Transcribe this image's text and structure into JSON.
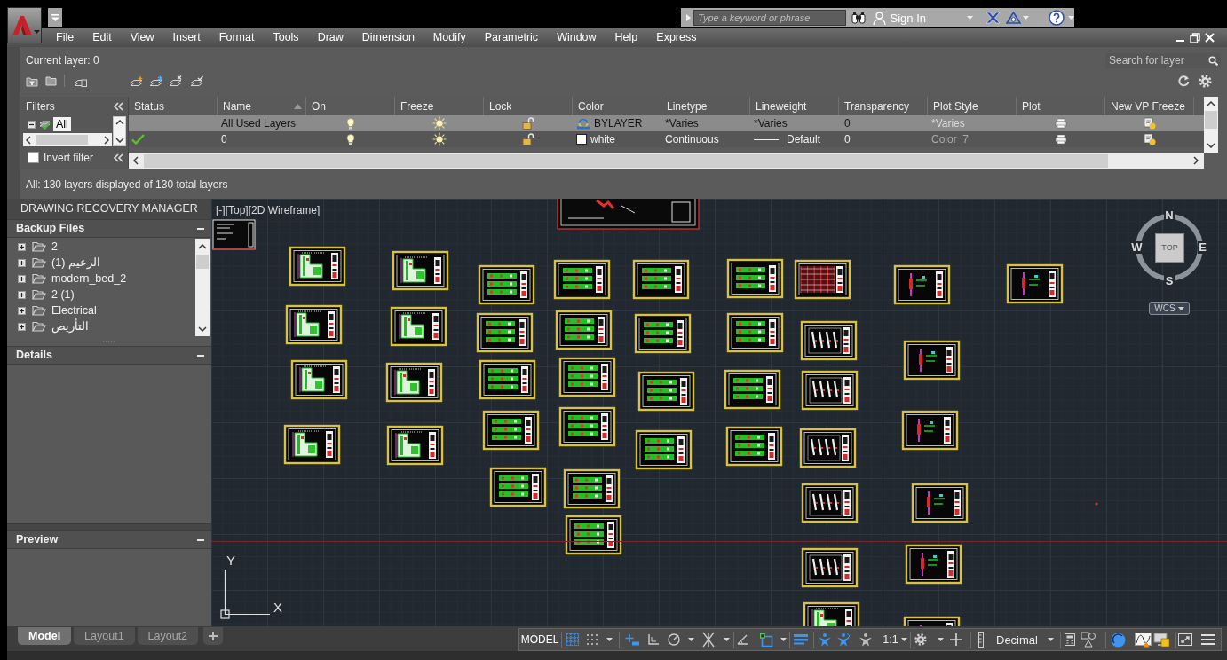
{
  "title_bar": {
    "search": {
      "placeholder": "Type a keyword or phrase"
    },
    "sign_in": "Sign In"
  },
  "menu_bar": [
    "File",
    "Edit",
    "View",
    "Insert",
    "Format",
    "Tools",
    "Draw",
    "Dimension",
    "Modify",
    "Parametric",
    "Window",
    "Help",
    "Express"
  ],
  "layer_manager": {
    "current_layer": "Current layer: 0",
    "search": {
      "placeholder": "Search for layer"
    },
    "filters": {
      "title": "Filters",
      "items": [
        {
          "label": "All",
          "selected": true,
          "expanded": true
        }
      ],
      "invert_filter": {
        "label": "Invert filter",
        "checked": false
      }
    },
    "columns": [
      {
        "label": "Status",
        "sorted": false
      },
      {
        "label": "Name",
        "sorted": true
      },
      {
        "label": "On",
        "sorted": false
      },
      {
        "label": "Freeze",
        "sorted": false
      },
      {
        "label": "Lock",
        "sorted": false
      },
      {
        "label": "Color",
        "sorted": false
      },
      {
        "label": "Linetype",
        "sorted": false
      },
      {
        "label": "Lineweight",
        "sorted": false
      },
      {
        "label": "Transparency",
        "sorted": false
      },
      {
        "label": "Plot Style",
        "sorted": false
      },
      {
        "label": "Plot",
        "sorted": false
      },
      {
        "label": "New VP Freeze",
        "sorted": false
      }
    ],
    "rows": [
      {
        "selected": true,
        "current": false,
        "name": "All Used Layers",
        "on": true,
        "frozen": false,
        "locked": false,
        "color_cell": {
          "kind": "bylayer",
          "label": "BYLAYER"
        },
        "linetype": "*Varies",
        "lineweight": "*Varies",
        "lineweight_sample": false,
        "transparency": "0",
        "plot_style": "*Varies",
        "plot": true,
        "vp_frozen": false
      },
      {
        "selected": false,
        "current": true,
        "name": "0",
        "on": true,
        "frozen": false,
        "locked": false,
        "color_cell": {
          "kind": "swatch",
          "color": "#ffffff",
          "label": "white"
        },
        "linetype": "Continuous",
        "lineweight": "Default",
        "lineweight_sample": true,
        "transparency": "0",
        "plot_style": "Color_7",
        "plot": true,
        "vp_frozen": false
      }
    ],
    "summary": "All: 130 layers displayed of 130 total layers"
  },
  "recovery_manager": {
    "title": "DRAWING RECOVERY MANAGER",
    "sections": [
      {
        "title": "Backup Files",
        "expanded": true,
        "items": [
          {
            "label": "2",
            "expanded": false
          },
          {
            "label": "الزعيم (1)",
            "expanded": false
          },
          {
            "label": "modern_bed_2",
            "expanded": false
          },
          {
            "label": "2 (1)",
            "expanded": false
          },
          {
            "label": "Electrical",
            "expanded": false
          },
          {
            "label": "التأريض",
            "expanded": false
          }
        ]
      },
      {
        "title": "Details",
        "expanded": true
      },
      {
        "title": "Preview",
        "expanded": true
      }
    ]
  },
  "viewport": {
    "label": "[-][Top][2D Wireframe]",
    "viewcube": {
      "face": "TOP",
      "north": "N",
      "south": "S",
      "east": "E",
      "west": "W",
      "ucs_menu": "WCS"
    },
    "ucs_icon": {
      "x_label": "X",
      "y_label": "Y"
    }
  },
  "layout_tabs": [
    {
      "label": "Model",
      "selected": true
    },
    {
      "label": "Layout1",
      "selected": false
    },
    {
      "label": "Layout2",
      "selected": false
    }
  ],
  "status_bar": {
    "space": "MODEL",
    "toggles": [
      {
        "on": true
      },
      {
        "on": false
      },
      {
        "on": true
      },
      {
        "on": false
      },
      {
        "on": false
      },
      {
        "on": false
      },
      {
        "on": false
      },
      {
        "on": true
      },
      {
        "on": true
      },
      {
        "on": true
      },
      {
        "on": true
      },
      {
        "on": true
      }
    ],
    "annotation_scale": "1:1",
    "units": "Decimal"
  }
}
